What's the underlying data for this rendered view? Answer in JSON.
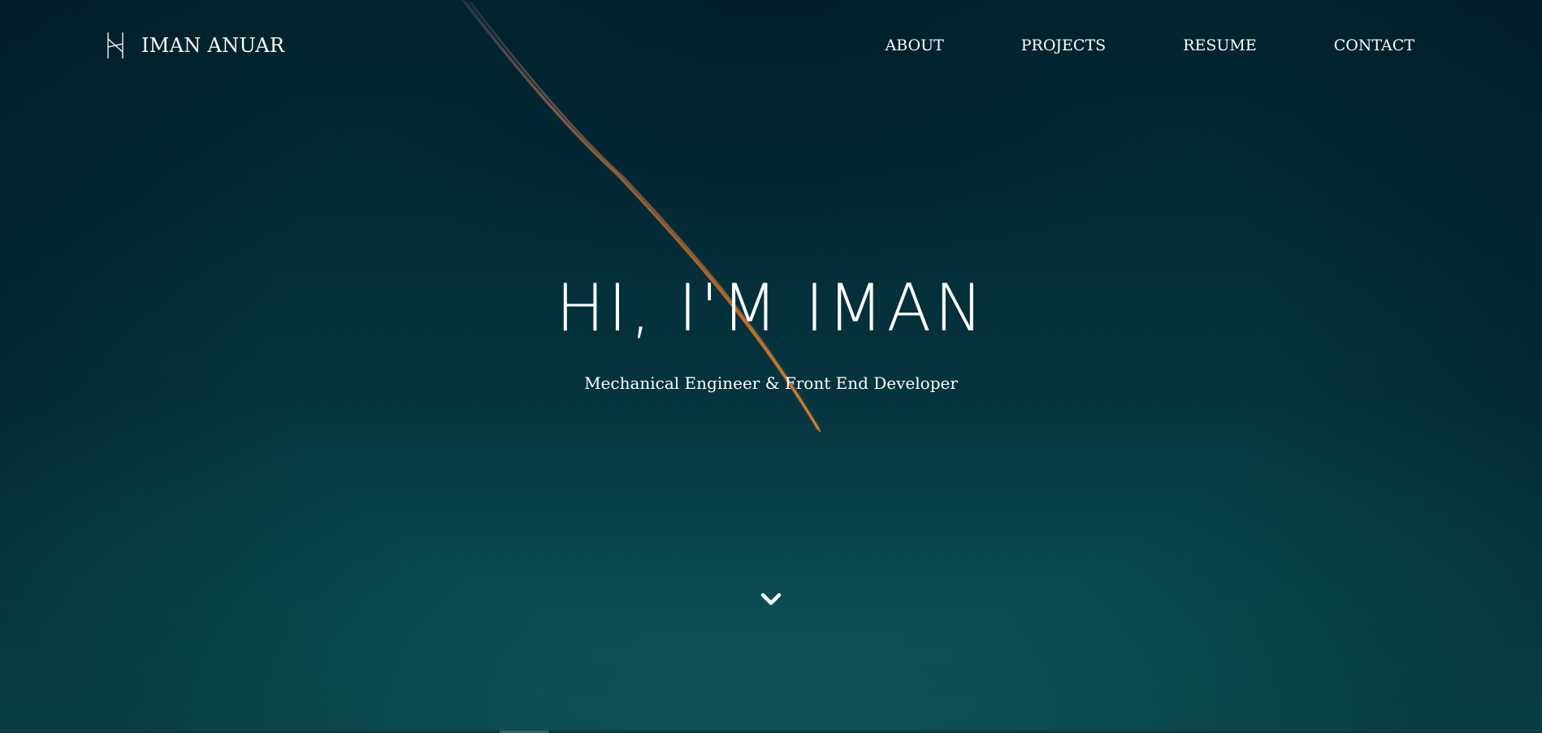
{
  "header": {
    "logo_icon": "monogram-logo-icon",
    "brand_name": "IMAN ANUAR",
    "nav": [
      {
        "label": "ABOUT"
      },
      {
        "label": "PROJECTS"
      },
      {
        "label": "RESUME"
      },
      {
        "label": "CONTACT"
      }
    ]
  },
  "hero": {
    "headline": "HI, I'M IMAN",
    "subtitle": "Mechanical Engineer & Front End Developer",
    "scroll_icon": "chevron-down-icon"
  },
  "colors": {
    "background_top": "#022833",
    "background_bottom": "#0d5a60",
    "text": "#ffffff",
    "contrail": "#d0701a"
  }
}
